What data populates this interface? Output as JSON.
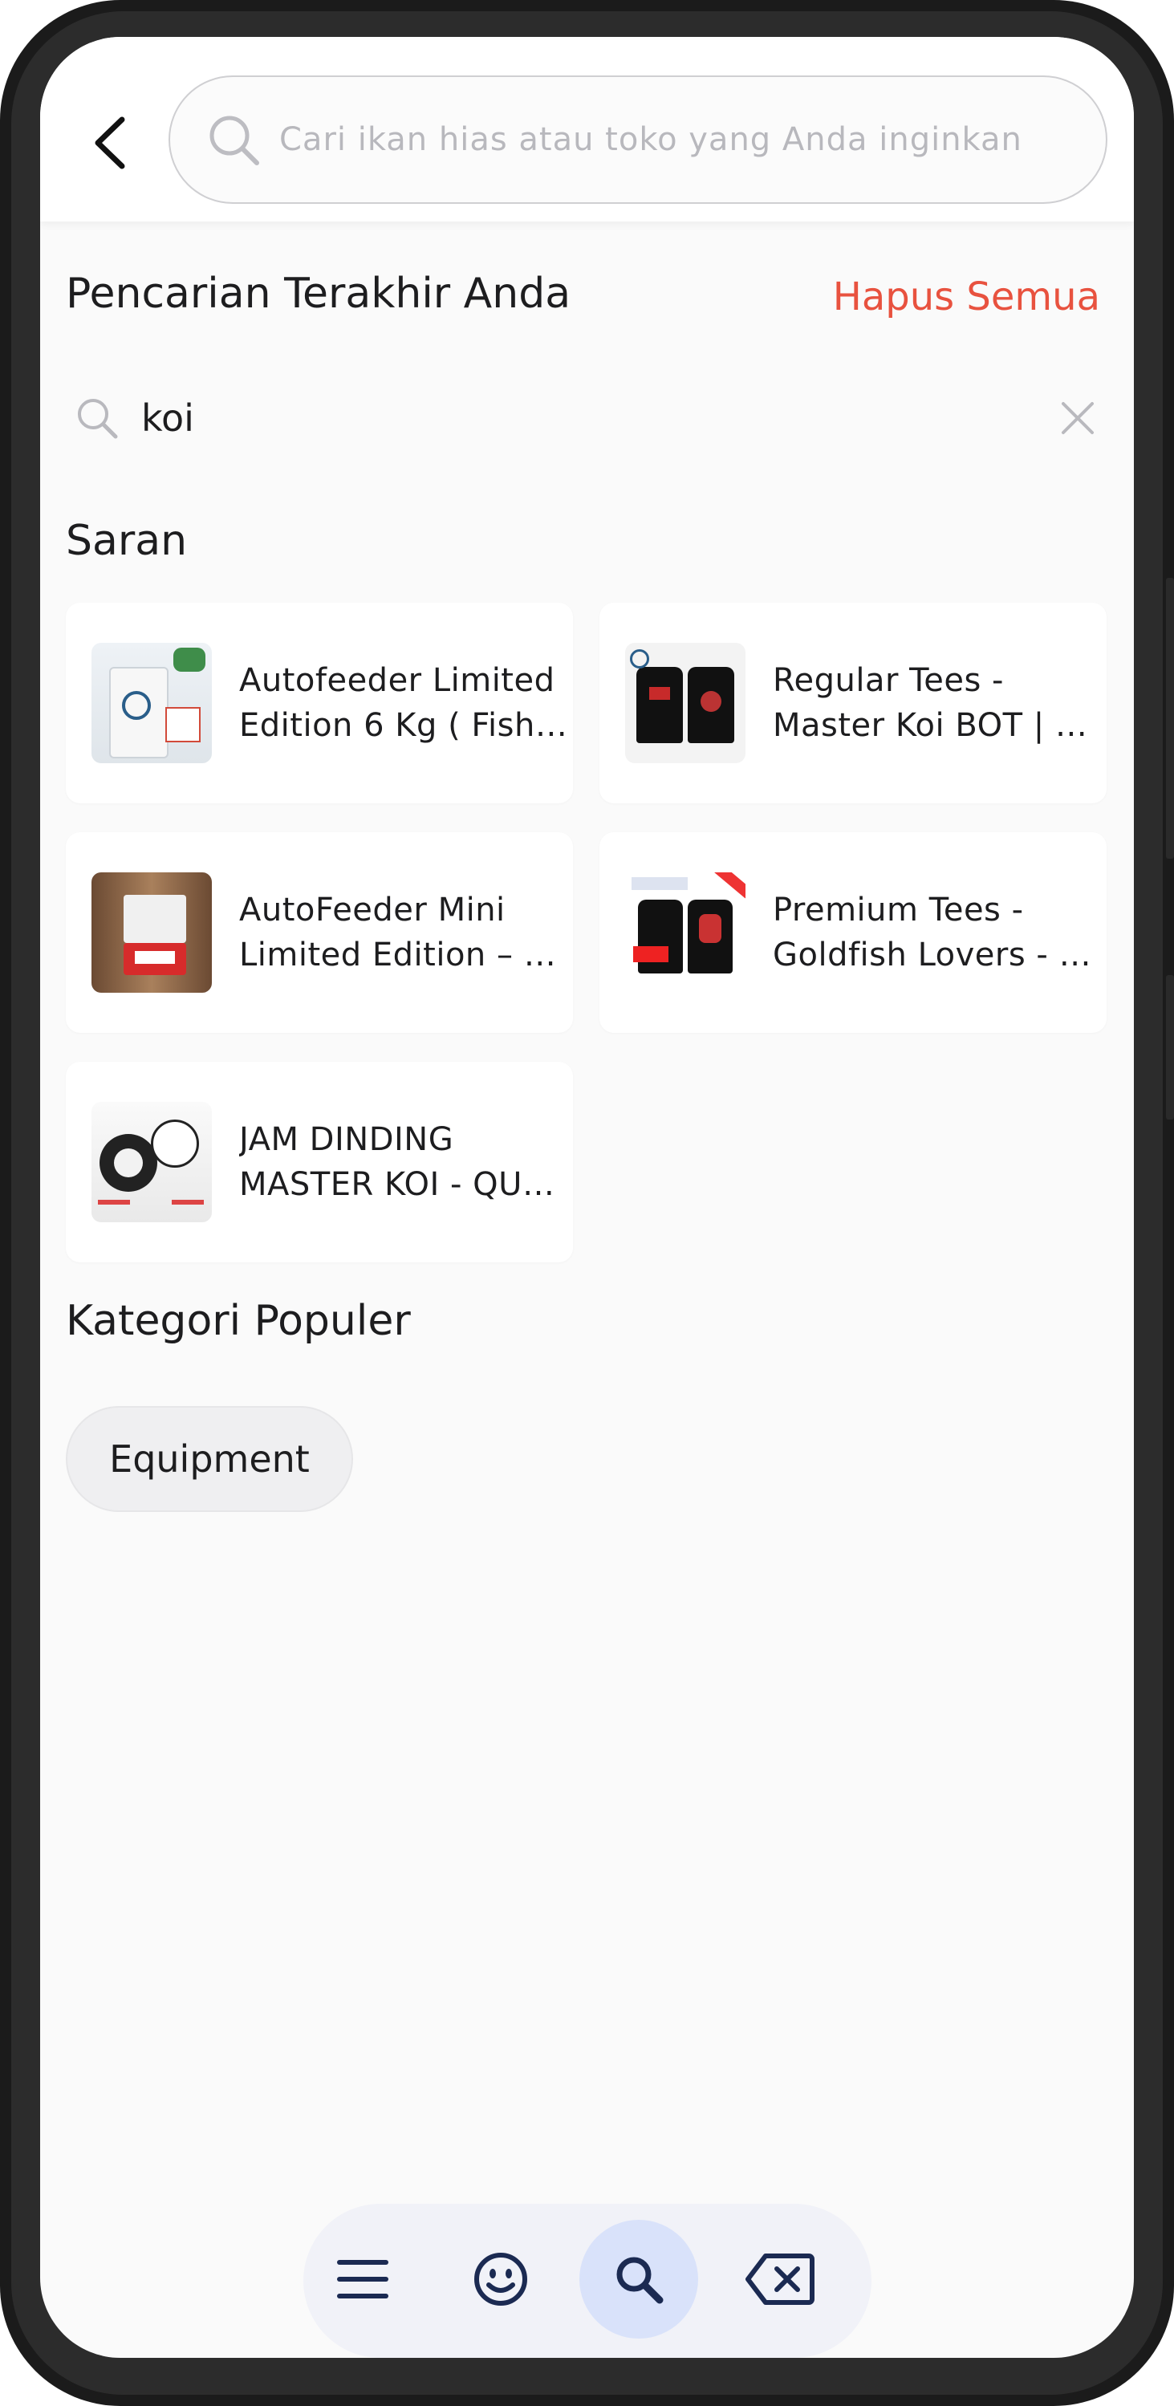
{
  "search": {
    "placeholder": "Cari ikan hias atau toko yang Anda inginkan",
    "value": ""
  },
  "recent": {
    "title": "Pencarian Terakhir Anda",
    "clear_all_label": "Hapus Semua",
    "items": [
      {
        "label": "koi"
      }
    ]
  },
  "suggestions": {
    "title": "Saran",
    "items": [
      {
        "line1": "Autofeeder Limited",
        "line2": "Edition 6 Kg ( Fish ..."
      },
      {
        "line1": "Regular Tees -",
        "line2": "Master Koi BOT | Ex..."
      },
      {
        "line1": "AutoFeeder Mini",
        "line2": "Limited Edition – K..."
      },
      {
        "line1": "Premium Tees -",
        "line2": "Goldfish Lovers - V..."
      },
      {
        "line1": "JAM DINDING",
        "line2": "MASTER KOI - QUA..."
      }
    ]
  },
  "popular": {
    "title": "Kategori Populer",
    "chips": [
      {
        "label": "Equipment"
      }
    ]
  },
  "bottom_nav": {
    "items": [
      {
        "icon": "menu-icon"
      },
      {
        "icon": "emoji-icon"
      },
      {
        "icon": "search-icon",
        "active": true
      },
      {
        "icon": "backspace-icon"
      }
    ]
  },
  "colors": {
    "accent_red": "#e8523f",
    "nav_active": "#d9e2fa",
    "nav_icon": "#1b2a52"
  }
}
